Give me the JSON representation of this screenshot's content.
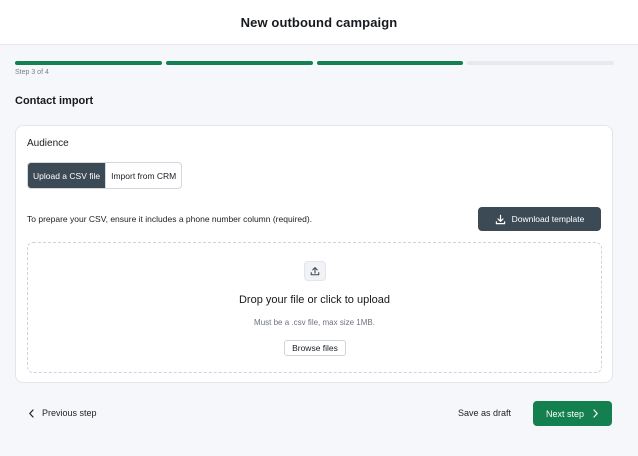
{
  "header": {
    "title": "New outbound campaign"
  },
  "progress": {
    "current_step": 3,
    "total_steps": 4,
    "step_label": "Step 3 of 4",
    "completed_color": "#14804f"
  },
  "section": {
    "title": "Contact import"
  },
  "audience": {
    "label": "Audience",
    "options": [
      "Upload a CSV file",
      "Import from CRM"
    ],
    "selected": "Upload a CSV file"
  },
  "csv": {
    "hint": "To prepare your CSV, ensure it includes a phone number column (required).",
    "download_label": "Download template"
  },
  "dropzone": {
    "title": "Drop your file or click to upload",
    "subtitle": "Must be a .csv file, max size 1MB.",
    "browse_label": "Browse files",
    "icon": "upload-icon"
  },
  "footer": {
    "previous_label": "Previous step",
    "draft_label": "Save as draft",
    "next_label": "Next step"
  }
}
